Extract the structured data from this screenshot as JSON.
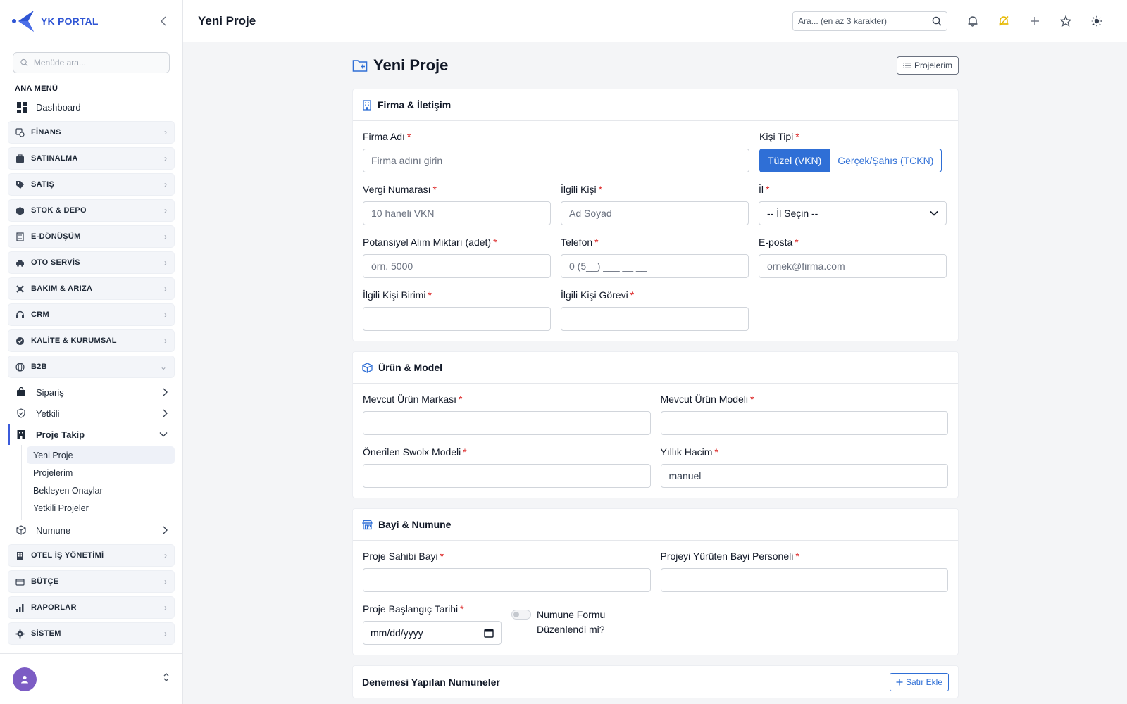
{
  "app": {
    "brand": "YK PORTAL",
    "page_title": "Yeni Proje"
  },
  "sidebar": {
    "search_placeholder": "Menüde ara...",
    "section_title": "ANA MENÜ",
    "dashboard_label": "Dashboard",
    "groups_top": [
      {
        "label": "FİNANS",
        "icon": "finance-icon"
      },
      {
        "label": "SATINALMA",
        "icon": "briefcase-icon"
      },
      {
        "label": "SATIŞ",
        "icon": "tag-icon"
      },
      {
        "label": "STOK & DEPO",
        "icon": "box-icon"
      },
      {
        "label": "E-DÖNÜŞÜM",
        "icon": "document-icon"
      },
      {
        "label": "OTO SERVİS",
        "icon": "car-icon"
      },
      {
        "label": "BAKIM & ARIZA",
        "icon": "tools-icon"
      },
      {
        "label": "CRM",
        "icon": "headset-icon"
      },
      {
        "label": "KALİTE & KURUMSAL",
        "icon": "badge-icon"
      },
      {
        "label": "B2B",
        "icon": "globe-icon"
      }
    ],
    "b2b_items": [
      {
        "label": "Sipariş"
      },
      {
        "label": "Yetkili"
      },
      {
        "label": "Proje Takip"
      }
    ],
    "proje_takip_children": [
      "Yeni Proje",
      "Projelerim",
      "Bekleyen Onaylar",
      "Yetkili Projeler"
    ],
    "numune_label": "Numune",
    "groups_bottom": [
      {
        "label": "OTEL İŞ YÖNETİMİ"
      },
      {
        "label": "BÜTÇE"
      },
      {
        "label": "RAPORLAR"
      },
      {
        "label": "SİSTEM"
      }
    ]
  },
  "topbar": {
    "title": "Yeni Proje",
    "search_placeholder": "Ara... (en az 3 karakter)"
  },
  "main": {
    "title": "Yeni Proje",
    "projelerim_button": "Projelerim",
    "firma_card": {
      "title": "Firma & İletişim",
      "firma_adi": {
        "label": "Firma Adı",
        "placeholder": "Firma adını girin"
      },
      "kisi_tipi": {
        "label": "Kişi Tipi",
        "options": [
          "Tüzel (VKN)",
          "Gerçek/Şahıs (TCKN)"
        ],
        "selected": "Tüzel (VKN)"
      },
      "vergi_no": {
        "label": "Vergi Numarası",
        "placeholder": "10 haneli VKN"
      },
      "ilgili_kisi": {
        "label": "İlgili Kişi",
        "placeholder": "Ad Soyad"
      },
      "il": {
        "label": "İl",
        "value": "-- İl Seçin --"
      },
      "potansiyel": {
        "label": "Potansiyel Alım Miktarı (adet)",
        "placeholder": "örn. 5000"
      },
      "telefon": {
        "label": "Telefon",
        "placeholder": "0 (5__) ___ __ __"
      },
      "eposta": {
        "label": "E-posta",
        "placeholder": "ornek@firma.com"
      },
      "birim": {
        "label": "İlgili Kişi Birimi",
        "placeholder": ""
      },
      "gorev": {
        "label": "İlgili Kişi Görevi",
        "placeholder": ""
      }
    },
    "urun_card": {
      "title": "Ürün & Model",
      "marka": {
        "label": "Mevcut Ürün Markası",
        "placeholder": ""
      },
      "model": {
        "label": "Mevcut Ürün Modeli",
        "placeholder": ""
      },
      "swolx": {
        "label": "Önerilen Swolx Modeli",
        "placeholder": ""
      },
      "hacim": {
        "label": "Yıllık Hacim",
        "value": "manuel"
      }
    },
    "bayi_card": {
      "title": "Bayi & Numune",
      "sahibi": {
        "label": "Proje Sahibi Bayi",
        "placeholder": ""
      },
      "personel": {
        "label": "Projeyi Yürüten Bayi Personeli",
        "placeholder": ""
      },
      "baslangic": {
        "label": "Proje Başlangıç Tarihi",
        "value": "mm/dd/yyyy"
      },
      "numune_toggle": "Numune Formu Düzenlendi mi?"
    },
    "numuneler_card": {
      "title": "Denemesi Yapılan Numuneler",
      "add_button": "Satır Ekle"
    }
  },
  "colors": {
    "accent": "#2f6fd6",
    "brand": "#2f55d4",
    "required": "#dc2626",
    "avatar": "#7c5cc4"
  }
}
